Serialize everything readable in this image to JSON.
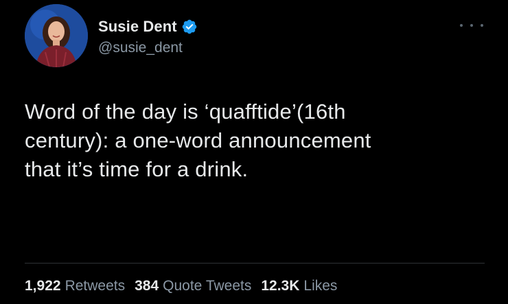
{
  "author": {
    "display_name": "Susie Dent",
    "handle": "@susie_dent",
    "verified": true,
    "avatar_icon": "profile-photo",
    "verified_color": "#1d9bf0"
  },
  "menu": {
    "icon": "more-horizontal-icon"
  },
  "tweet": {
    "text_lines": [
      "Word of the day is ‘quafftide’(16th",
      "century): a one-word announcement",
      "that it’s time for a drink."
    ]
  },
  "stats": {
    "retweets": {
      "count": "1,922",
      "label": "Retweets"
    },
    "quote_tweets": {
      "count": "384",
      "label": "Quote Tweets"
    },
    "likes": {
      "count": "12.3K",
      "label": "Likes"
    }
  },
  "colors": {
    "background": "#000000",
    "primary_text": "#e7e9ea",
    "secondary_text": "#8b98a5",
    "divider": "#2f3336"
  }
}
